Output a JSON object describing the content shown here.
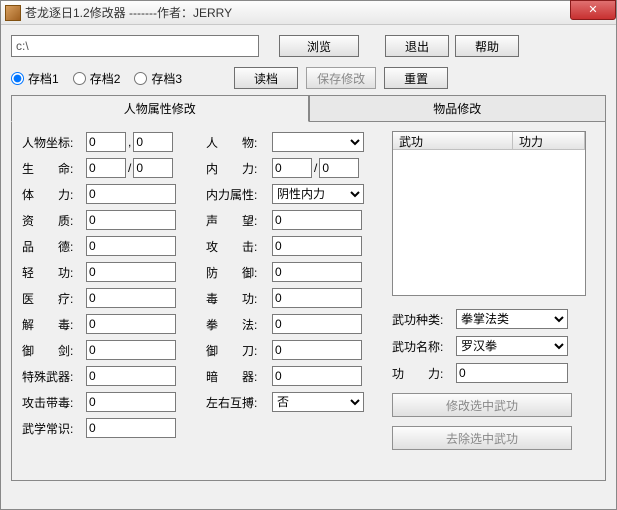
{
  "title": "苍龙逐日1.2修改器     -------作者：JERRY",
  "close_glyph": "✕",
  "path_value": "c:\\",
  "buttons": {
    "browse": "浏览",
    "exit": "退出",
    "help": "帮助",
    "load": "读档",
    "save_mod": "保存修改",
    "reset": "重置"
  },
  "slots": {
    "s1": "存档1",
    "s2": "存档2",
    "s3": "存档3",
    "selected": "s1"
  },
  "tabs": {
    "char": "人物属性修改",
    "item": "物品修改"
  },
  "fields_left": {
    "coord": "人物坐标:",
    "life": "生　　命:",
    "stamina": "体　　力:",
    "aptitude": "资　　质:",
    "virtue": "品　　德:",
    "lightfoot": "轻　　功:",
    "medical": "医　　疗:",
    "detox": "解　　毒:",
    "sword": "御　　剑:",
    "special": "特殊武器:",
    "poisonatk": "攻击带毒:",
    "knowledge": "武学常识:"
  },
  "fields_mid": {
    "person": "人　　物:",
    "neili": "内　　力:",
    "nl_attr": "内力属性:",
    "repute": "声　　望:",
    "attack": "攻　　击:",
    "defense": "防　　御:",
    "poison": "毒　　功:",
    "fist": "拳　　法:",
    "blade": "御　　刀:",
    "hidden": "暗　　器:",
    "ambi": "左右互搏:"
  },
  "values": {
    "coord_x": "0",
    "coord_y": "0",
    "life_cur": "0",
    "life_max": "0",
    "stamina": "0",
    "aptitude": "0",
    "virtue": "0",
    "lightfoot": "0",
    "medical": "0",
    "detox": "0",
    "sword": "0",
    "special": "0",
    "poisonatk": "0",
    "knowledge": "0",
    "neili_cur": "0",
    "neili_max": "0",
    "repute": "0",
    "attack": "0",
    "defense": "0",
    "poison": "0",
    "fist": "0",
    "blade": "0",
    "hidden": "0",
    "coord_sep": ",",
    "slash": "/"
  },
  "dropdowns": {
    "nl_attr_sel": "阴性内力",
    "ambi_sel": "否"
  },
  "right": {
    "list_col1": "武功",
    "list_col2": "功力",
    "kind_lbl": "武功种类:",
    "kind_sel": "拳掌法类",
    "name_lbl": "武功名称:",
    "name_sel": "罗汉拳",
    "power_lbl": "功　　力:",
    "power_val": "0",
    "mod_btn": "修改选中武功",
    "del_btn": "去除选中武功"
  }
}
